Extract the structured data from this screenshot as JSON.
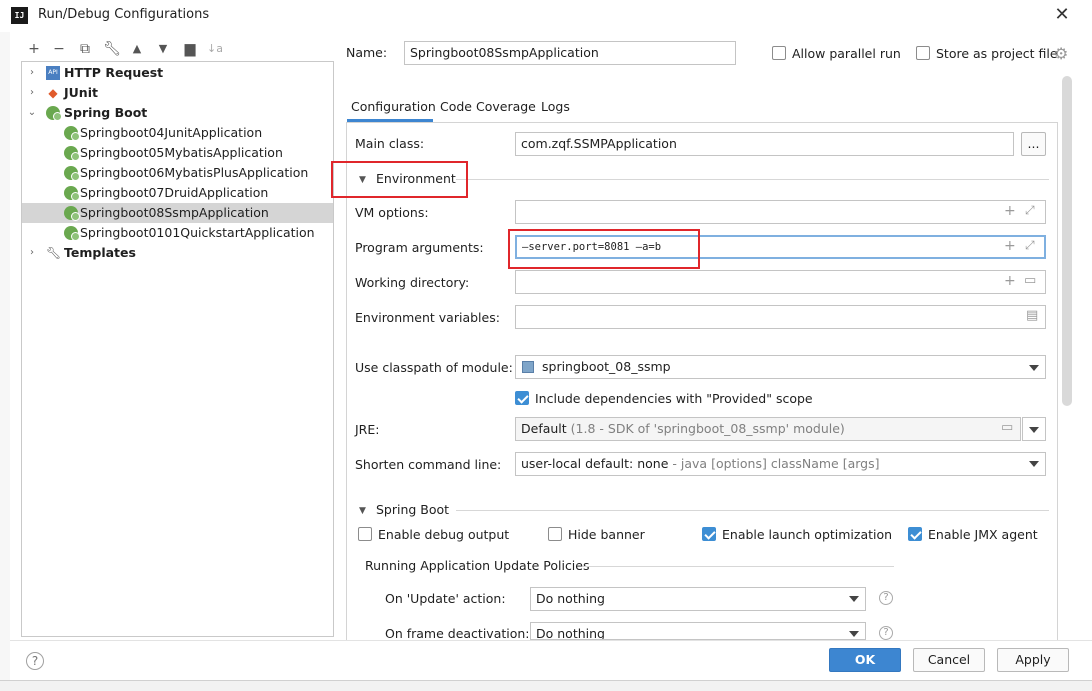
{
  "window": {
    "title": "Run/Debug Configurations",
    "logo": "IJ"
  },
  "toolbar": {
    "icons": [
      "add-icon",
      "remove-icon",
      "copy-icon",
      "wrench-icon",
      "move-up-icon",
      "move-down-icon",
      "folder-add-icon",
      "sort-icon"
    ]
  },
  "tree": {
    "items": [
      {
        "label": "HTTP Request",
        "bold": true,
        "icon": "api-icon",
        "level": 0
      },
      {
        "label": "JUnit",
        "bold": true,
        "icon": "junit-icon",
        "level": 0
      },
      {
        "label": "Spring Boot",
        "bold": true,
        "icon": "spring-icon",
        "level": 0,
        "expanded": true
      },
      {
        "label": "Springboot04JunitApplication",
        "level": 1
      },
      {
        "label": "Springboot05MybatisApplication",
        "level": 1
      },
      {
        "label": "Springboot06MybatisPlusApplication",
        "level": 1
      },
      {
        "label": "Springboot07DruidApplication",
        "level": 1
      },
      {
        "label": "Springboot08SsmpApplication",
        "level": 1,
        "selected": true
      },
      {
        "label": "Springboot0101QuickstartApplication",
        "level": 1
      },
      {
        "label": "Templates",
        "bold": true,
        "icon": "wrench-icon",
        "level": 0
      }
    ]
  },
  "name_row": {
    "label": "Name:",
    "value": "Springboot08SsmpApplication",
    "allow_parallel": "Allow parallel run",
    "store_project": "Store as project file"
  },
  "tabs": [
    "Configuration",
    "Code Coverage",
    "Logs"
  ],
  "form": {
    "main_class_label": "Main class:",
    "main_class_value": "com.zqf.SSMPApplication",
    "browse_btn": "...",
    "environment_header": "Environment",
    "vm_options_label": "VM options:",
    "vm_options_value": "",
    "program_args_label": "Program arguments:",
    "program_args_value": "—server.port=8081 —a=b",
    "working_dir_label": "Working directory:",
    "working_dir_value": "",
    "env_vars_label": "Environment variables:",
    "env_vars_value": "",
    "classpath_label": "Use classpath of module:",
    "classpath_value": "springboot_08_ssmp",
    "include_deps": "Include dependencies with \"Provided\" scope",
    "jre_label": "JRE:",
    "jre_value": "Default",
    "jre_hint": "(1.8 - SDK of 'springboot_08_ssmp' module)",
    "shorten_label": "Shorten command line:",
    "shorten_value": "user-local default: none",
    "shorten_hint": "- java [options] className [args]",
    "spring_boot_header": "Spring Boot",
    "enable_debug": "Enable debug output",
    "hide_banner": "Hide banner",
    "launch_opt": "Enable launch optimization",
    "jmx_agent": "Enable JMX agent",
    "update_policies_header": "Running Application Update Policies",
    "on_update_label": "On 'Update' action:",
    "on_update_value": "Do nothing",
    "on_frame_label": "On frame deactivation:",
    "on_frame_value": "Do nothing"
  },
  "footer": {
    "help": "?",
    "ok": "OK",
    "cancel": "Cancel",
    "apply": "Apply"
  },
  "colors": {
    "accent": "#3d86d1",
    "highlight_box": "#e0262b",
    "selection": "#d5d5d5"
  }
}
